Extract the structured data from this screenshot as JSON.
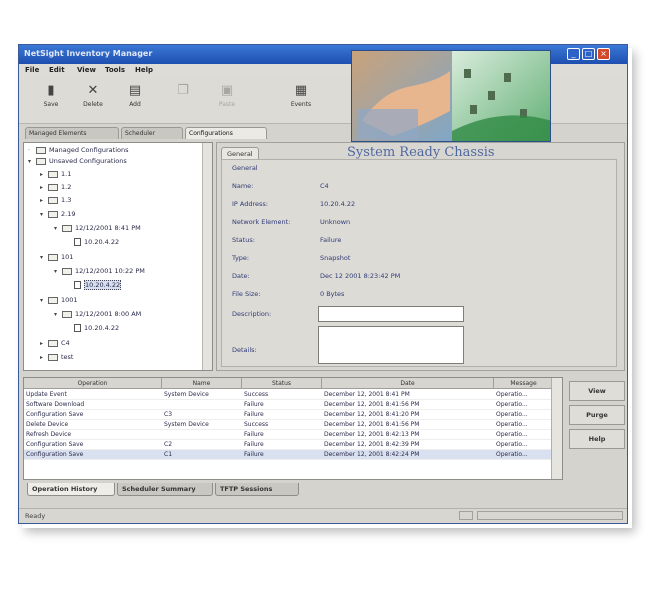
{
  "window": {
    "title": "NetSight Inventory Manager"
  },
  "menu": [
    "File",
    "Edit",
    "View",
    "Tools",
    "Help"
  ],
  "toolbar": [
    {
      "label": "Save",
      "icon": "save-icon"
    },
    {
      "label": "Delete",
      "icon": "delete-icon"
    },
    {
      "label": "Add",
      "icon": "add-icon"
    },
    {
      "label": "",
      "icon": "copy-icon"
    },
    {
      "label": "Paste",
      "icon": "paste-icon"
    },
    {
      "label": "Events",
      "icon": "events-icon"
    }
  ],
  "nav_tabs": [
    "Managed Elements",
    "Scheduler",
    "Configurations"
  ],
  "banner": {
    "watermark": "System Ready Chassis"
  },
  "tree": {
    "nodes": [
      {
        "label": "Managed Configurations"
      },
      {
        "label": "Unsaved Configurations"
      },
      {
        "label": "1.1"
      },
      {
        "label": "1.2"
      },
      {
        "label": "1.3"
      },
      {
        "label": "2.19"
      },
      {
        "label": "12/12/2001 8:41 PM"
      },
      {
        "label": "10.20.4.22"
      },
      {
        "label": "101"
      },
      {
        "label": "12/12/2001 10:22 PM"
      },
      {
        "label": "10.20.4.22"
      },
      {
        "label": "1001"
      },
      {
        "label": "12/12/2001 8:00 AM"
      },
      {
        "label": "10.20.4.22"
      },
      {
        "label": "C4"
      },
      {
        "label": "test"
      }
    ]
  },
  "props": {
    "tab": "General",
    "section": "General",
    "fields": [
      {
        "label": "Name:",
        "value": "C4"
      },
      {
        "label": "IP Address:",
        "value": "10.20.4.22"
      },
      {
        "label": "Network Element:",
        "value": "Unknown"
      },
      {
        "label": "Status:",
        "value": "Failure"
      },
      {
        "label": "Type:",
        "value": "Snapshot"
      },
      {
        "label": "Date:",
        "value": "Dec 12 2001 8:23:42 PM"
      },
      {
        "label": "File Size:",
        "value": "0 Bytes"
      }
    ],
    "description_label": "Description:",
    "details_label": "Details:"
  },
  "history": {
    "columns": [
      "Operation",
      "Name",
      "Status",
      "Date",
      "Message"
    ],
    "rows": [
      {
        "op": "Update Event",
        "name": "System Device",
        "status": "Success",
        "date": "December 12, 2001 8:41 PM",
        "msg": "Operatio..."
      },
      {
        "op": "Software Download",
        "name": "",
        "status": "Failure",
        "date": "December 12, 2001 8:41:56 PM",
        "msg": "Operatio..."
      },
      {
        "op": "Configuration Save",
        "name": "C3",
        "status": "Failure",
        "date": "December 12, 2001 8:41:20 PM",
        "msg": "Operatio..."
      },
      {
        "op": "Delete Device",
        "name": "System Device",
        "status": "Success",
        "date": "December 12, 2001 8:41:56 PM",
        "msg": "Operatio..."
      },
      {
        "op": "Refresh Device",
        "name": "",
        "status": "Failure",
        "date": "December 12, 2001 8:42:13 PM",
        "msg": "Operatio..."
      },
      {
        "op": "Configuration Save",
        "name": "C2",
        "status": "Failure",
        "date": "December 12, 2001 8:42:39 PM",
        "msg": "Operatio..."
      },
      {
        "op": "Configuration Save",
        "name": "C1",
        "status": "Failure",
        "date": "December 12, 2001 8:42:24 PM",
        "msg": "Operatio..."
      }
    ]
  },
  "side_buttons": [
    "View",
    "Purge",
    "Help"
  ],
  "bottom_tabs": [
    "Operation History",
    "Scheduler Summary",
    "TFTP Sessions"
  ],
  "status": {
    "text": "Ready"
  },
  "colors": {
    "titlebar": "#2a5fc4",
    "accent_text": "#2f3a78"
  }
}
